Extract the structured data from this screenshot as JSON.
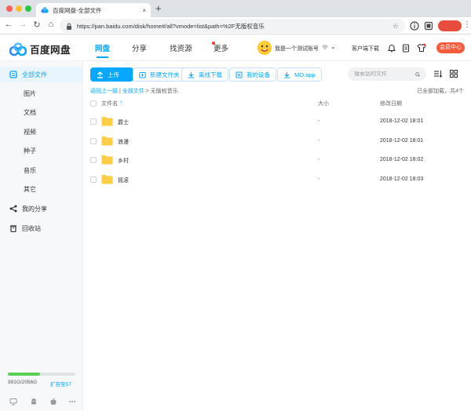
{
  "browser": {
    "tab_title": "百度网盘-全部文件",
    "tab_close": "×",
    "new_tab": "+",
    "url": "https://pan.baidu.com/disk/home#/all?vmode=list&path=%2F无版权音乐",
    "back": "←",
    "forward": "→",
    "reload": "↻",
    "home": "⌂",
    "more": "⋮"
  },
  "header": {
    "logo_text": "百度网盘",
    "nav": [
      "网盘",
      "分享",
      "找资源",
      "更多"
    ],
    "active_nav": "网盘",
    "username": "我是一个测试账号",
    "client_download": "客户端下载",
    "vip_button": "会员中心",
    "caret": "⌄"
  },
  "sidebar": {
    "items": [
      {
        "label": "全部文件",
        "icon": "file-icon"
      },
      {
        "label": "图片"
      },
      {
        "label": "文档"
      },
      {
        "label": "视频"
      },
      {
        "label": "种子"
      },
      {
        "label": "音乐"
      },
      {
        "label": "其它"
      },
      {
        "label": "我的分享",
        "icon": "share-icon"
      },
      {
        "label": "回收站",
        "icon": "trash-icon"
      }
    ],
    "quota_text": "991G/2056G",
    "quota_fraction": 0.48,
    "expand_label": "扩容至5T"
  },
  "toolbar": {
    "upload": "上传",
    "new_folder": "新建文件夹",
    "offline_download": "离线下载",
    "my_devices": "我的设备",
    "mo_app": "MO.app",
    "search_placeholder": "搜索您的文件"
  },
  "breadcrumb": {
    "back": "返回上一级",
    "sep1": "|",
    "all": "全部文件",
    "sep2": ">",
    "current": "无版权音乐"
  },
  "loaded_text": "已全部加载，共4个",
  "table": {
    "headers": {
      "name": "文件名",
      "size": "大小",
      "date": "修改日期"
    },
    "sort_arrow": "↑",
    "rows": [
      {
        "name": "爵士",
        "size": "-",
        "date": "2018-12-02 18:01"
      },
      {
        "name": "浪漫",
        "size": "-",
        "date": "2018-12-02 18:01"
      },
      {
        "name": "乡村",
        "size": "-",
        "date": "2018-12-02 18:02"
      },
      {
        "name": "摇滚",
        "size": "-",
        "date": "2018-12-02 18:03"
      }
    ]
  },
  "colors": {
    "accent": "#06a7ff",
    "vip": "#f45c3c",
    "folder": "#ffcd45",
    "quota": "#5ccf58"
  }
}
